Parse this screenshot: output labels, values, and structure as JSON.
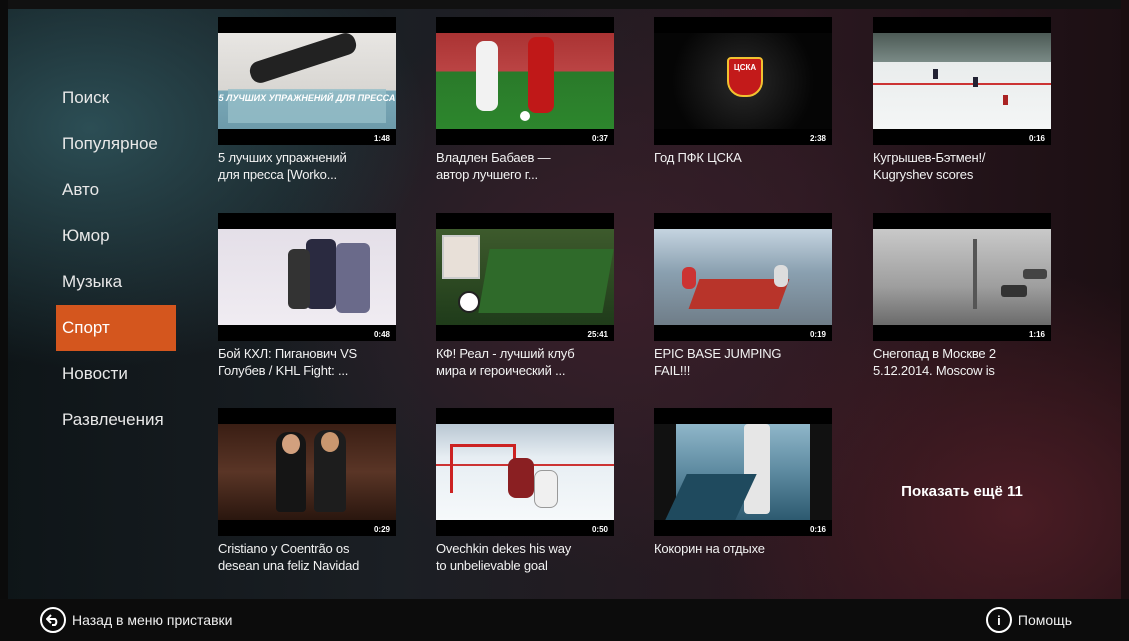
{
  "menu": {
    "items": [
      {
        "label": "Поиск"
      },
      {
        "label": "Популярное"
      },
      {
        "label": "Авто"
      },
      {
        "label": "Юмор"
      },
      {
        "label": "Музыка"
      },
      {
        "label": "Спорт",
        "active": true
      },
      {
        "label": "Новости"
      },
      {
        "label": "Развлечения"
      }
    ]
  },
  "videos": [
    {
      "title_line1": "5 лучших упражнений",
      "title_line2": "для пресса [Worko...",
      "duration": "1:48",
      "overlay": "5 ЛУЧШИХ УПРАЖНЕНИЙ ДЛЯ ПРЕССА"
    },
    {
      "title_line1": "Владлен Бабаев —",
      "title_line2": "автор лучшего г...",
      "duration": "0:37"
    },
    {
      "title_line1": "Год ПФК ЦСКА",
      "title_line2": "",
      "duration": "2:38",
      "overlay": "ЦСКА"
    },
    {
      "title_line1": "Кугрышев-Бэтмен!/",
      "title_line2": "Kugryshev scores",
      "duration": "0:16"
    },
    {
      "title_line1": "Бой КХЛ: Пиганович VS",
      "title_line2": "Голубев / KHL Fight: ...",
      "duration": "0:48"
    },
    {
      "title_line1": "КФ! Реал - лучший клуб",
      "title_line2": "мира и героический ...",
      "duration": "25:41"
    },
    {
      "title_line1": "EPIC BASE JUMPING",
      "title_line2": "FAIL!!!",
      "duration": "0:19"
    },
    {
      "title_line1": "Снегопад в Москве 2",
      "title_line2": "5.12.2014. Moscow is",
      "duration": "1:16"
    },
    {
      "title_line1": "Cristiano y Coentrão os",
      "title_line2": "desean una feliz Navidad",
      "duration": "0:29"
    },
    {
      "title_line1": "Ovechkin dekes his way",
      "title_line2": "to unbelievable goal",
      "duration": "0:50"
    },
    {
      "title_line1": "Кокорин на отдыхе",
      "title_line2": "",
      "duration": "0:16"
    }
  ],
  "show_more": "Показать ещё 11",
  "footer": {
    "back_label": "Назад в меню приставки",
    "help_label": "Помощь",
    "back_icon": "back-arrow-icon",
    "help_icon": "info-icon"
  },
  "colors": {
    "accent": "#d4561e"
  }
}
